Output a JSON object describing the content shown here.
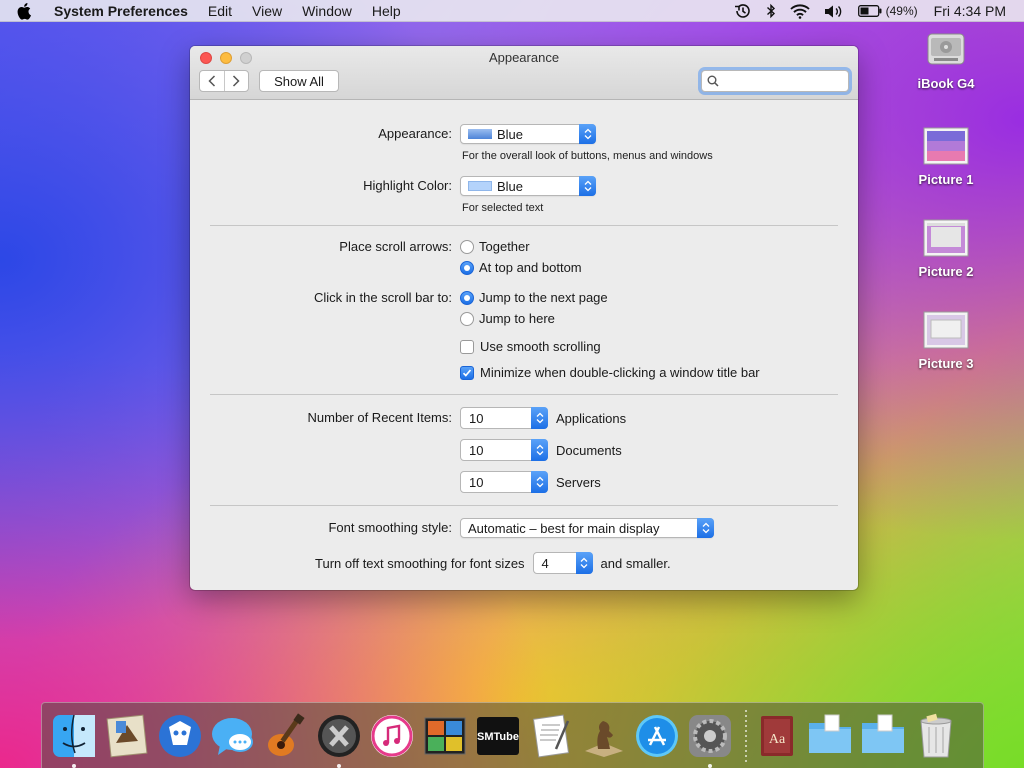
{
  "menubar": {
    "app_name": "System Preferences",
    "items": [
      "Edit",
      "View",
      "Window",
      "Help"
    ],
    "battery": "(49%)",
    "clock": "Fri 4:34 PM"
  },
  "desktop": {
    "icons": [
      {
        "label": "iBook G4",
        "icon": "hard-drive-icon"
      },
      {
        "label": "Picture 1",
        "icon": "image-file-icon"
      },
      {
        "label": "Picture 2",
        "icon": "image-file-icon"
      },
      {
        "label": "Picture 3",
        "icon": "image-file-icon"
      }
    ]
  },
  "window": {
    "title": "Appearance",
    "show_all": "Show All",
    "search_value": "",
    "appearance": {
      "label": "Appearance:",
      "value": "Blue",
      "hint": "For the overall look of buttons, menus and windows",
      "swatch_color": "#6a9be0"
    },
    "highlight": {
      "label": "Highlight Color:",
      "value": "Blue",
      "hint": "For selected text",
      "swatch_color": "#b4d3fb"
    },
    "scroll_arrows": {
      "label": "Place scroll arrows:",
      "options": [
        {
          "label": "Together",
          "selected": false
        },
        {
          "label": "At top and bottom",
          "selected": true
        }
      ]
    },
    "scroll_click": {
      "label": "Click in the scroll bar to:",
      "options": [
        {
          "label": "Jump to the next page",
          "selected": true
        },
        {
          "label": "Jump to here",
          "selected": false
        }
      ]
    },
    "checkboxes": [
      {
        "label": "Use smooth scrolling",
        "checked": false
      },
      {
        "label": "Minimize when double-clicking a window title bar",
        "checked": true
      }
    ],
    "recent_items": {
      "label": "Number of Recent Items:",
      "rows": [
        {
          "value": "10",
          "label": "Applications"
        },
        {
          "value": "10",
          "label": "Documents"
        },
        {
          "value": "10",
          "label": "Servers"
        }
      ]
    },
    "font_smoothing": {
      "label": "Font smoothing style:",
      "value": "Automatic – best for main display"
    },
    "text_smoothing": {
      "label": "Turn off text smoothing for font sizes",
      "value": "4",
      "suffix": "and smaller."
    },
    "help": "?"
  },
  "dock": {
    "items": [
      "finder-icon",
      "mail-icon",
      "adium-icon",
      "messages-icon",
      "garageband-icon",
      "mac-os-x-icon",
      "itunes-icon",
      "photo-booth-icon",
      "smtube-icon",
      "textedit-icon",
      "chess-icon",
      "app-store-icon",
      "system-preferences-icon",
      "dictionary-icon",
      "folder-icon",
      "folder-icon",
      "trash-icon"
    ],
    "smtube_label": "SMTube",
    "dictionary_label": "Aa"
  }
}
